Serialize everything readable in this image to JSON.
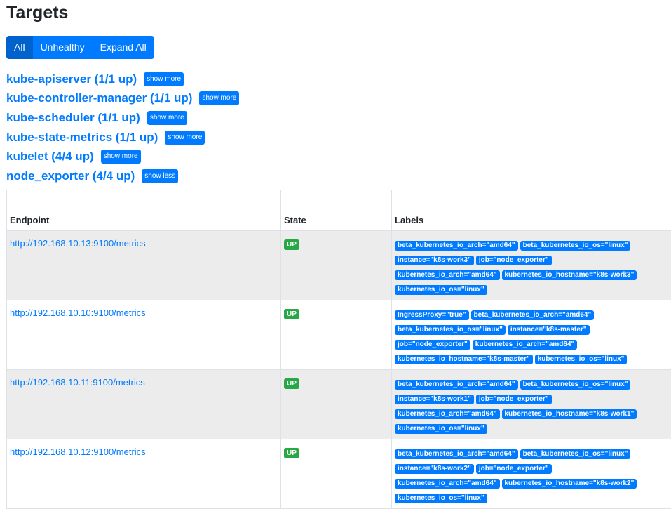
{
  "page": {
    "title": "Targets"
  },
  "filters": {
    "all": "All",
    "unhealthy": "Unhealthy",
    "expand_all": "Expand All",
    "active": "All"
  },
  "jobs": [
    {
      "name": "kube-apiserver (1/1 up)",
      "toggle": "show more"
    },
    {
      "name": "kube-controller-manager (1/1 up)",
      "toggle": "show more"
    },
    {
      "name": "kube-scheduler (1/1 up)",
      "toggle": "show more"
    },
    {
      "name": "kube-state-metrics (1/1 up)",
      "toggle": "show more"
    },
    {
      "name": "kubelet (4/4 up)",
      "toggle": "show more"
    },
    {
      "name": "node_exporter (4/4 up)",
      "toggle": "show less"
    }
  ],
  "table": {
    "headers": {
      "endpoint": "Endpoint",
      "state": "State",
      "labels": "Labels"
    },
    "rows": [
      {
        "endpoint": "http://192.168.10.13:9100/metrics",
        "state": "UP",
        "label_lines": [
          [
            "beta_kubernetes_io_arch=\"amd64\"",
            "beta_kubernetes_io_os=\"linux\""
          ],
          [
            "instance=\"k8s-work3\"",
            "job=\"node_exporter\""
          ],
          [
            "kubernetes_io_arch=\"amd64\"",
            "kubernetes_io_hostname=\"k8s-work3\""
          ],
          [
            "kubernetes_io_os=\"linux\""
          ]
        ]
      },
      {
        "endpoint": "http://192.168.10.10:9100/metrics",
        "state": "UP",
        "label_lines": [
          [
            "IngressProxy=\"true\"",
            "beta_kubernetes_io_arch=\"amd64\""
          ],
          [
            "beta_kubernetes_io_os=\"linux\"",
            "instance=\"k8s-master\""
          ],
          [
            "job=\"node_exporter\"",
            "kubernetes_io_arch=\"amd64\""
          ],
          [
            "kubernetes_io_hostname=\"k8s-master\"",
            "kubernetes_io_os=\"linux\""
          ]
        ]
      },
      {
        "endpoint": "http://192.168.10.11:9100/metrics",
        "state": "UP",
        "label_lines": [
          [
            "beta_kubernetes_io_arch=\"amd64\"",
            "beta_kubernetes_io_os=\"linux\""
          ],
          [
            "instance=\"k8s-work1\"",
            "job=\"node_exporter\""
          ],
          [
            "kubernetes_io_arch=\"amd64\"",
            "kubernetes_io_hostname=\"k8s-work1\""
          ],
          [
            "kubernetes_io_os=\"linux\""
          ]
        ]
      },
      {
        "endpoint": "http://192.168.10.12:9100/metrics",
        "state": "UP",
        "label_lines": [
          [
            "beta_kubernetes_io_arch=\"amd64\"",
            "beta_kubernetes_io_os=\"linux\""
          ],
          [
            "instance=\"k8s-work2\"",
            "job=\"node_exporter\""
          ],
          [
            "kubernetes_io_arch=\"amd64\"",
            "kubernetes_io_hostname=\"k8s-work2\""
          ],
          [
            "kubernetes_io_os=\"linux\""
          ]
        ]
      }
    ]
  },
  "colors": {
    "primary": "#007bff",
    "success": "#28a745",
    "row_shade": "#ececec"
  }
}
